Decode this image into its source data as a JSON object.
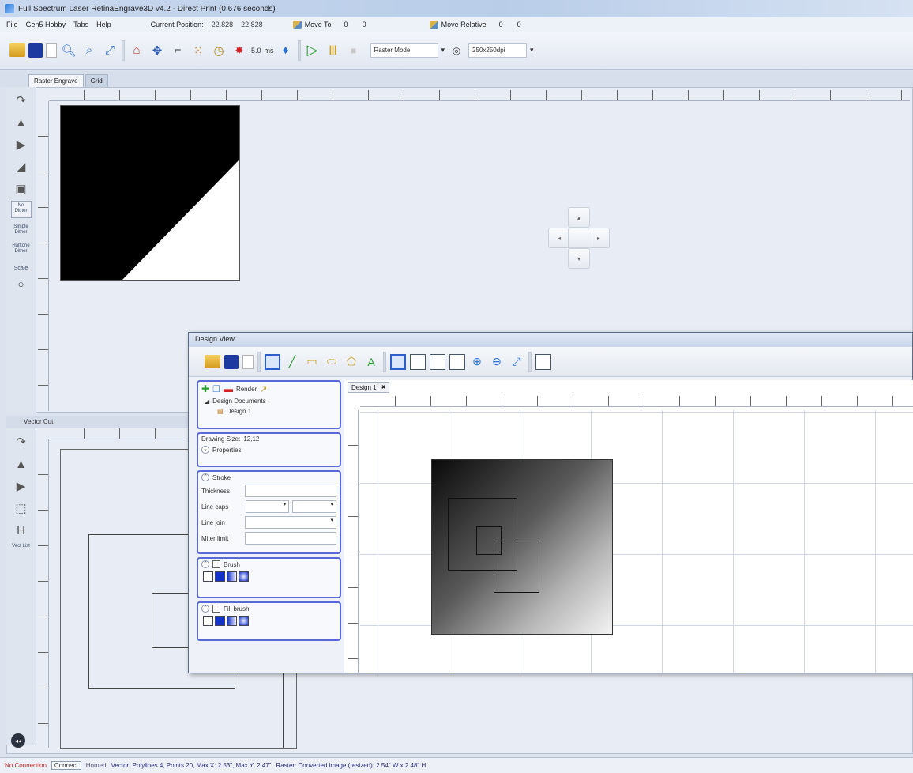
{
  "window": {
    "title": "Full Spectrum Laser RetinaEngrave3D v4.2 - Direct Print (0.676 seconds)"
  },
  "menu": {
    "items": [
      "File",
      "Gen5 Hobby",
      "Tabs",
      "Help"
    ],
    "current_position_label": "Current Position:",
    "current_position_x": "22.828",
    "current_position_y": "22.828",
    "move_to_label": "Move To",
    "move_to_x": "0",
    "move_to_y": "0",
    "move_relative_label": "Move Relative",
    "move_relative_x": "0",
    "move_relative_y": "0"
  },
  "toolbar": {
    "power_value": "5.0",
    "power_unit": "ms",
    "mode": "Raster Mode",
    "resolution": "250x250dpi"
  },
  "tabs": [
    {
      "label": "Raster Engrave",
      "active": true
    },
    {
      "label": "Grid",
      "active": false
    }
  ],
  "raster_tools": {
    "labels": [
      "No Dither",
      "Simple Dither",
      "Halftone Dither"
    ],
    "scale_label": "Scale"
  },
  "vector": {
    "panel_label": "Vector Cut",
    "tool_labels": [
      "Vect List"
    ]
  },
  "status": {
    "connection": "No Connection",
    "connect_button": "Connect",
    "homed": "Homed",
    "vector_info": "Vector: Polylines 4, Points 20, Max X: 2.53\", Max Y: 2.47\"",
    "raster_info": "Raster: Converted image (resized): 2.54\" W x 2.48\" H"
  },
  "design_view": {
    "title": "Design View",
    "render_label": "Render",
    "tree_root": "Design Documents",
    "tree_child": "Design 1",
    "drawing_size_label": "Drawing Size:",
    "drawing_size_value": "12,12",
    "properties_label": "Properties",
    "stroke_label": "Stroke",
    "thickness_label": "Thickness",
    "line_caps_label": "Line caps",
    "line_join_label": "Line join",
    "miter_limit_label": "Miter limit",
    "brush_label": "Brush",
    "fill_brush_label": "Fill brush",
    "document_tab": "Design 1",
    "document_tab_close": "✖"
  },
  "colors": {
    "accent_blue": "#5967d9",
    "error_red": "#d42020"
  }
}
